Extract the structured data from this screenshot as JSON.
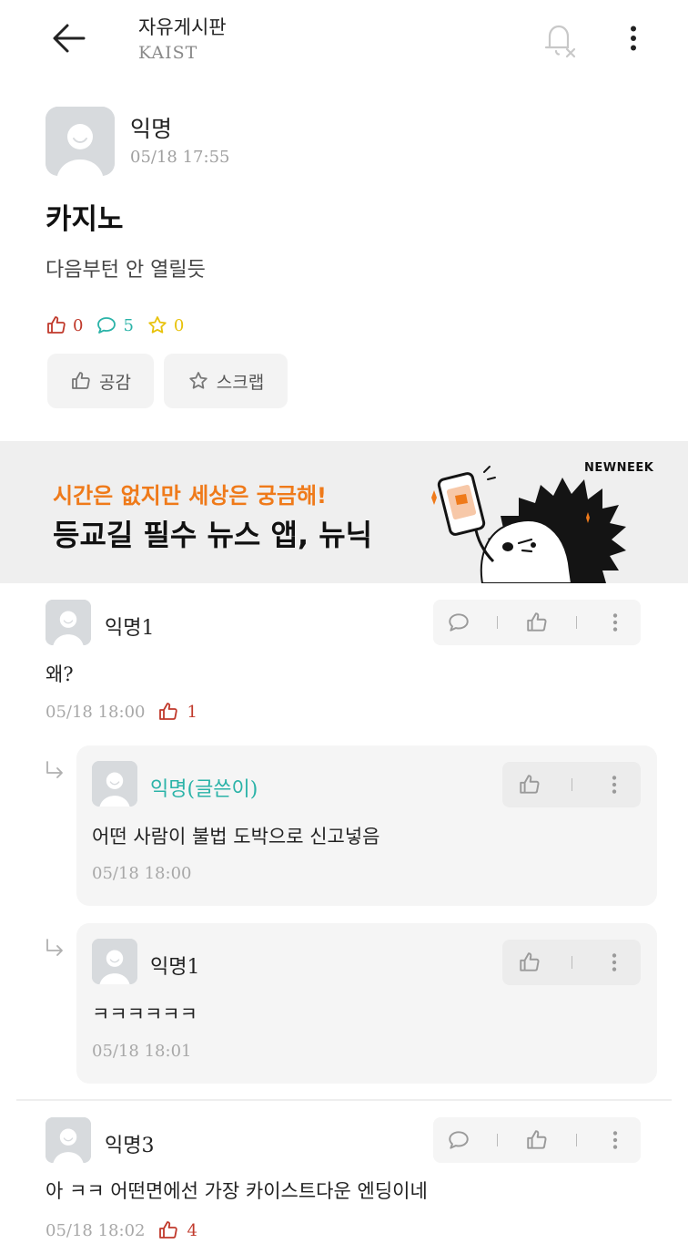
{
  "header": {
    "title": "자유게시판",
    "subtitle": "KAIST"
  },
  "post": {
    "author": "익명",
    "time": "05/18 17:55",
    "title": "카지노",
    "body": "다음부턴 안 열릴듯",
    "likes": "0",
    "comments": "5",
    "scraps": "0",
    "empathy_label": "공감",
    "scrap_label": "스크랩"
  },
  "ad": {
    "line1": "시간은 없지만 세상은 궁금해!",
    "line2": "등교길 필수 뉴스 앱, 뉴닉",
    "brand": "NEWNEEK"
  },
  "comments": [
    {
      "author": "익명1",
      "text": "왜?",
      "time": "05/18 18:00",
      "likes": "1",
      "replies": [
        {
          "author": "익명(글쓴이)",
          "text": "어떤 사람이 불법 도박으로 신고넣음",
          "time": "05/18 18:00"
        },
        {
          "author": "익명1",
          "text": "ㅋㅋㅋㅋㅋㅋ",
          "time": "05/18 18:01"
        }
      ]
    },
    {
      "author": "익명3",
      "text": "아 ㅋㅋ 어떤면에선 가장 카이스트다운 엔딩이네",
      "time": "05/18 18:02",
      "likes": "4"
    }
  ],
  "colors": {
    "like": "#c0392b",
    "comment": "#2bb3a8",
    "scrap": "#e8c20b",
    "ad_accent": "#ef7a1a"
  }
}
